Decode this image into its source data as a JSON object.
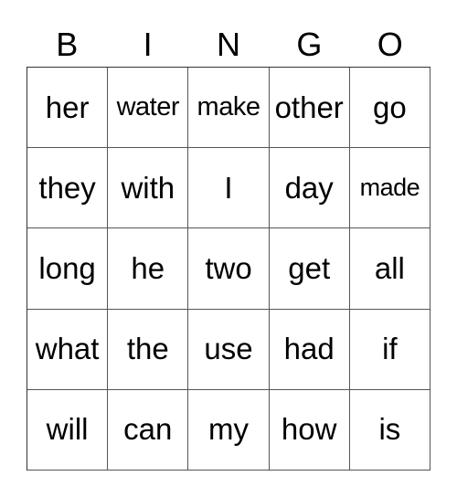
{
  "header": {
    "letters": [
      "B",
      "I",
      "N",
      "G",
      "O"
    ]
  },
  "card": {
    "rows": [
      [
        "her",
        "water",
        "make",
        "other",
        "go"
      ],
      [
        "they",
        "with",
        "I",
        "day",
        "made"
      ],
      [
        "long",
        "he",
        "two",
        "get",
        "all"
      ],
      [
        "what",
        "the",
        "use",
        "had",
        "if"
      ],
      [
        "will",
        "can",
        "my",
        "how",
        "is"
      ]
    ]
  }
}
